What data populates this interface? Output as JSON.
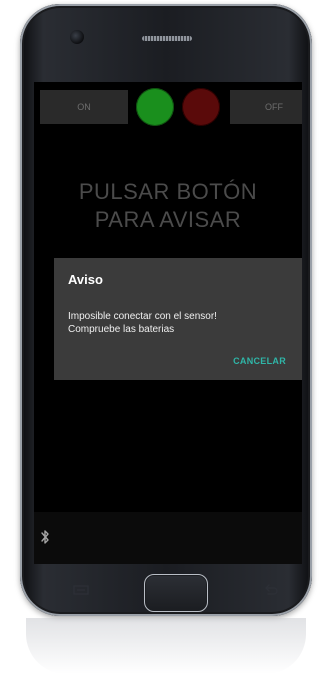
{
  "app": {
    "on_label": "ON",
    "off_label": "OFF",
    "headline_line1": "PULSAR BOTÓN",
    "headline_line2": "PARA AVISAR",
    "led_colors": {
      "green": "#1a8f1d",
      "red": "#5a0a0a"
    }
  },
  "dialog": {
    "title": "Aviso",
    "message_line1": "Imposible conectar con el sensor!",
    "message_line2": "Compruebe las baterias",
    "cancel_label": "CANCELAR",
    "accent_color": "#2fb6a8"
  },
  "status": {
    "icons": [
      "bluetooth-icon"
    ]
  },
  "device": {
    "buttons": [
      "menu-key-icon",
      "home-button",
      "back-key-icon"
    ]
  }
}
